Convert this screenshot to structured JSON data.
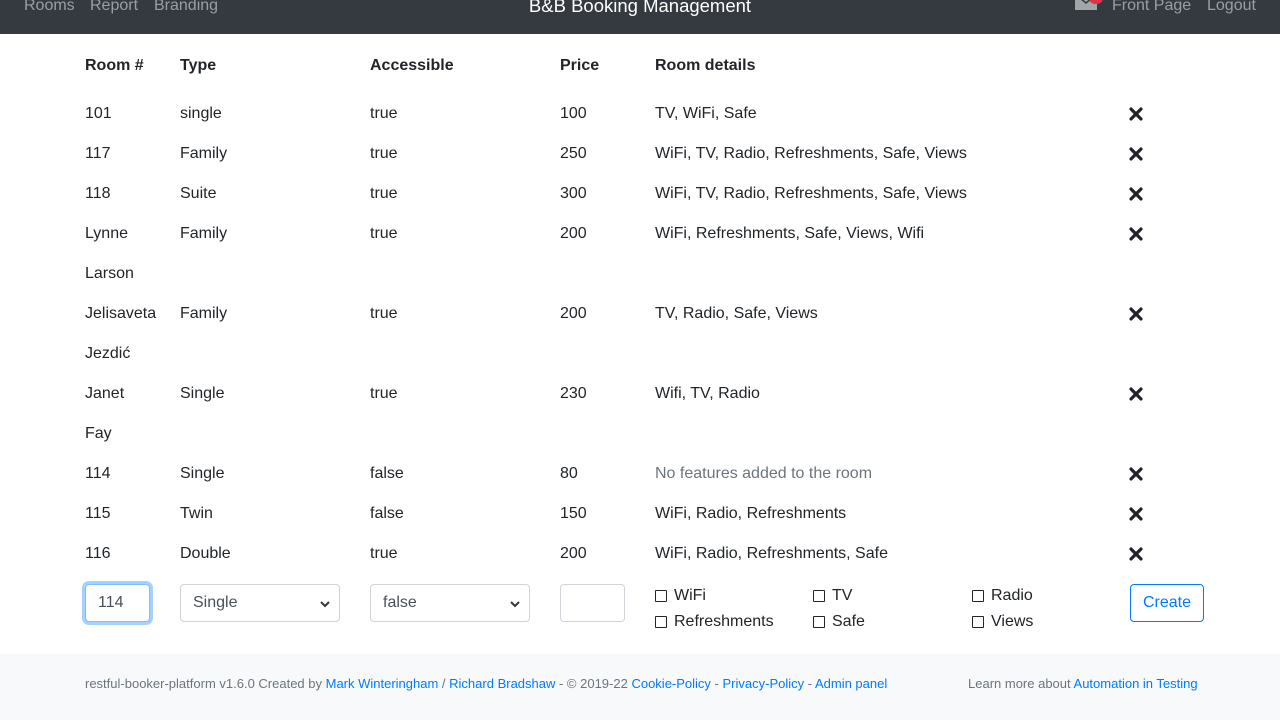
{
  "nav": {
    "links": [
      "Rooms",
      "Report",
      "Branding"
    ],
    "brand": "B&B Booking Management",
    "front_page": "Front Page",
    "logout": "Logout"
  },
  "table": {
    "headers": [
      "Room #",
      "Type",
      "Accessible",
      "Price",
      "Room details"
    ],
    "rows": [
      {
        "room": [
          "101"
        ],
        "type": "single",
        "accessible": "true",
        "price": "100",
        "details": "TV, WiFi, Safe"
      },
      {
        "room": [
          "117"
        ],
        "type": "Family",
        "accessible": "true",
        "price": "250",
        "details": "WiFi, TV, Radio, Refreshments, Safe, Views"
      },
      {
        "room": [
          "118"
        ],
        "type": "Suite",
        "accessible": "true",
        "price": "300",
        "details": "WiFi, TV, Radio, Refreshments, Safe, Views"
      },
      {
        "room": [
          "Lynne",
          "Larson"
        ],
        "type": "Family",
        "accessible": "true",
        "price": "200",
        "details": "WiFi, Refreshments, Safe, Views, Wifi"
      },
      {
        "room": [
          "Jelisaveta",
          "Jezdić"
        ],
        "type": "Family",
        "accessible": "true",
        "price": "200",
        "details": "TV, Radio, Safe, Views"
      },
      {
        "room": [
          "Janet",
          "Fay"
        ],
        "type": "Single",
        "accessible": "true",
        "price": "230",
        "details": "Wifi, TV, Radio"
      },
      {
        "room": [
          "114"
        ],
        "type": "Single",
        "accessible": "false",
        "price": "80",
        "details": "No features added to the room",
        "details_muted": true
      },
      {
        "room": [
          "115"
        ],
        "type": "Twin",
        "accessible": "false",
        "price": "150",
        "details": "WiFi, Radio, Refreshments"
      },
      {
        "room": [
          "116"
        ],
        "type": "Double",
        "accessible": "true",
        "price": "200",
        "details": "WiFi, Radio, Refreshments, Safe"
      }
    ]
  },
  "form": {
    "room_number_value": "114",
    "type_selected": "Single",
    "accessible_selected": "false",
    "price_value": "",
    "features": [
      "WiFi",
      "TV",
      "Radio",
      "Refreshments",
      "Safe",
      "Views"
    ],
    "create_label": "Create"
  },
  "footer": {
    "prefix": "restful-booker-platform v1.6.0 Created by ",
    "author1": "Mark Winteringham",
    "sep1": " / ",
    "author2": "Richard Bradshaw",
    "copyright": " - © 2019-22 ",
    "cookie": "Cookie-Policy",
    "dash1": " - ",
    "privacy": "Privacy-Policy",
    "dash2": " - ",
    "admin": "Admin panel",
    "learn": "Learn more about ",
    "ait": "Automation in Testing"
  },
  "colors": {
    "navbar": "#343a40",
    "link": "#007bff",
    "badge": "#dc3545",
    "footer_bg": "#f8f9fa"
  }
}
